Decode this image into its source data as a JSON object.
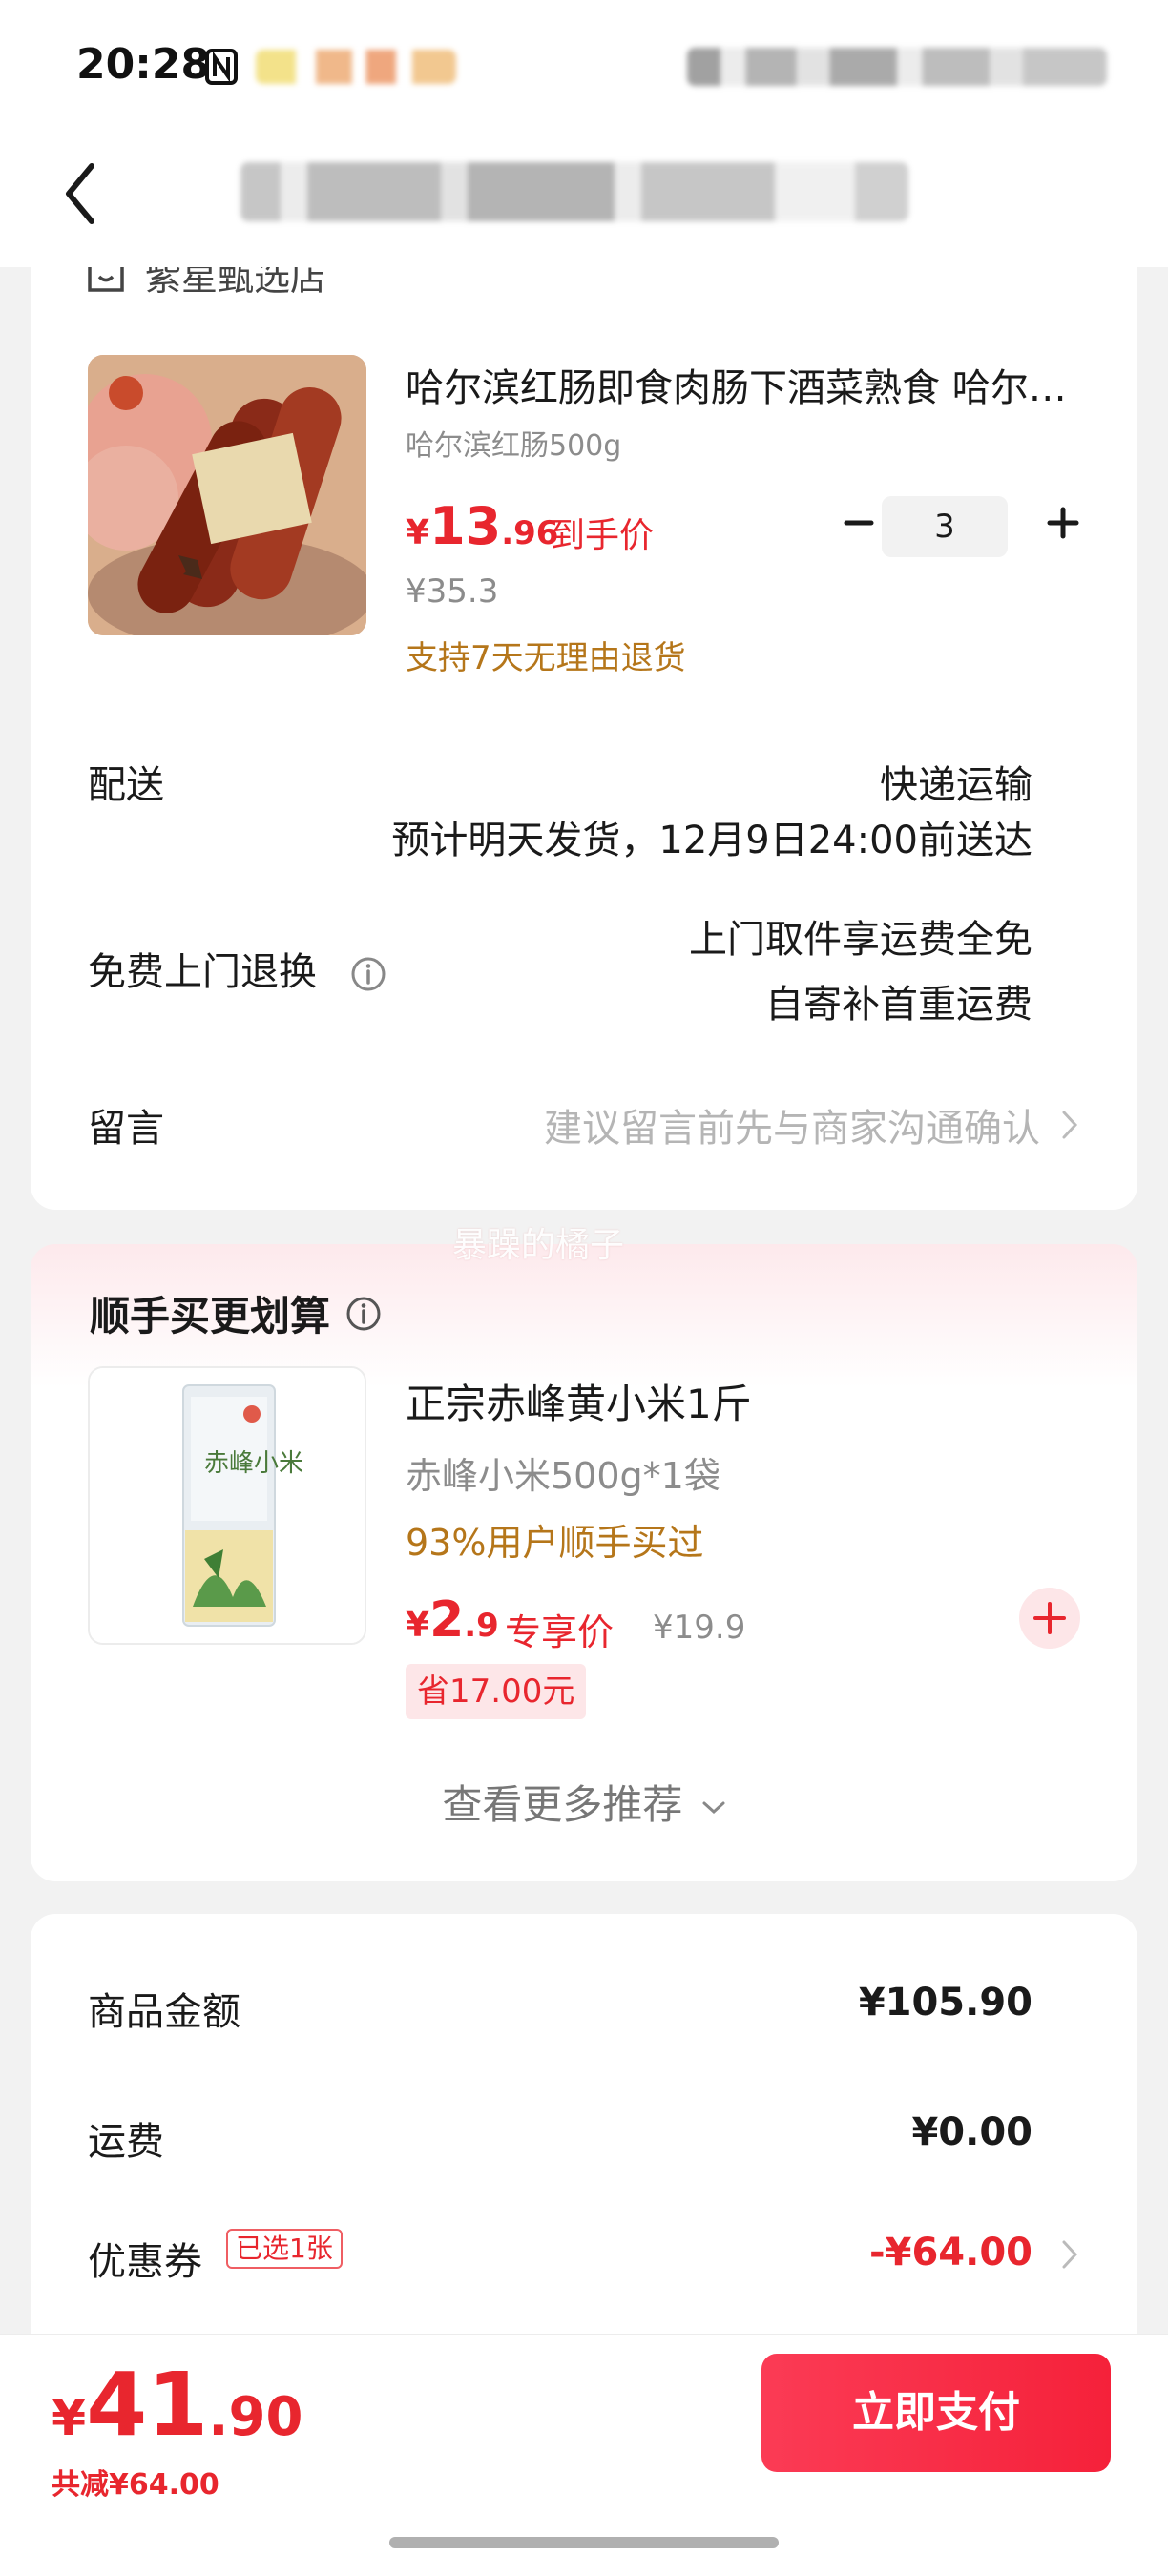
{
  "status_bar": {
    "time": "20:28"
  },
  "shop": {
    "name": "紫星甄选店"
  },
  "product": {
    "title": "哈尔滨红肠即食肉肠下酒菜熟食 哈尔滨红肠特产",
    "spec": "哈尔滨红肠500g",
    "price_currency": "¥",
    "price_int": "13",
    "price_dec": ".96",
    "price_tag": "到手价",
    "original_price": "¥35.3",
    "return_policy": "支持7天无理由退货",
    "quantity": "3"
  },
  "delivery": {
    "label": "配送",
    "method": "快递运输",
    "estimate": "预计明天发货，12月9日24:00前送达"
  },
  "return_service": {
    "label": "免费上门退换",
    "line1": "上门取件享运费全免",
    "line2": "自寄补首重运费"
  },
  "message": {
    "label": "留言",
    "placeholder": "建议留言前先与商家沟通确认"
  },
  "watermark": "暴躁的橘子",
  "recommend": {
    "section_title": "顺手买更划算",
    "item": {
      "title": "正宗赤峰黄小米1斤",
      "spec": "赤峰小米500g*1袋",
      "bought": "93%用户顺手买过",
      "price_currency": "¥",
      "price_int": "2",
      "price_dec": ".9",
      "price_tag": "专享价",
      "original_price": "¥19.9",
      "save_badge": "省17.00元",
      "package_text": "赤峰小米"
    },
    "more_label": "查看更多推荐"
  },
  "summary": {
    "goods_label": "商品金额",
    "goods_value": "¥105.90",
    "shipping_label": "运费",
    "shipping_value": "¥0.00",
    "coupon_label": "优惠券",
    "coupon_badge": "已选1张",
    "coupon_value": "-¥64.00"
  },
  "footer": {
    "total_currency": "¥",
    "total_int": "41",
    "total_dec": ".90",
    "saved": "共减¥64.00",
    "pay_button": "立即支付"
  },
  "colors": {
    "accent_red": "#e8262e",
    "gold_text": "#b5761a",
    "pay_button": "#f5213a"
  },
  "icons": [
    "nfc-icon",
    "back-arrow-icon",
    "shop-icon",
    "minus-icon",
    "plus-icon",
    "info-icon",
    "chevron-right-icon",
    "chevron-down-icon",
    "add-circle-icon"
  ]
}
